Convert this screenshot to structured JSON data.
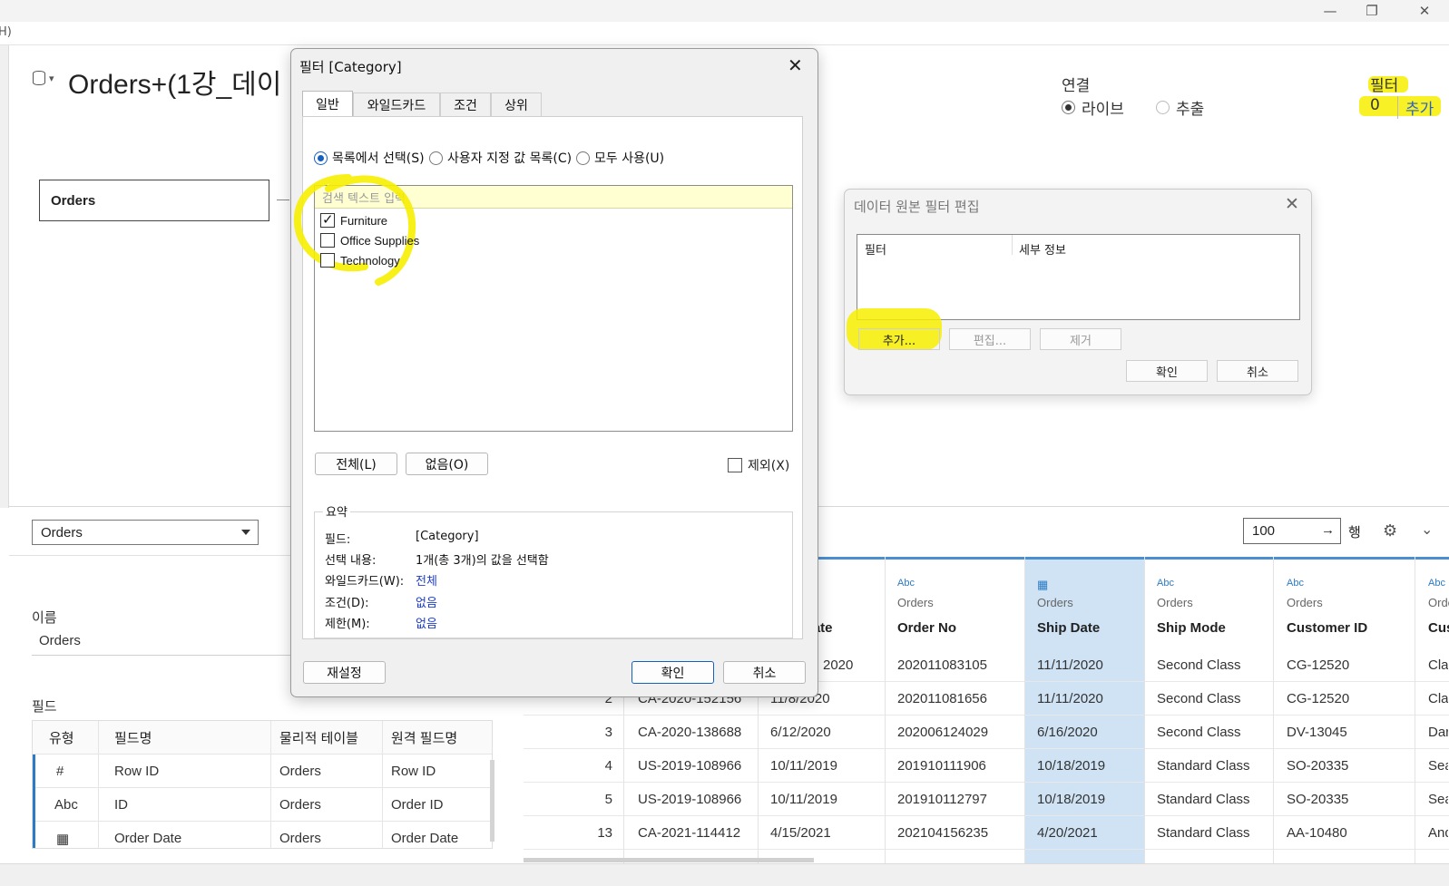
{
  "window": {
    "minimize": "—",
    "maximize": "❐",
    "close": "✕"
  },
  "menubar": {
    "first_char": "H)"
  },
  "datasource": {
    "title": "Orders+(1강_데이",
    "table_box": "Orders",
    "icon": "database-icon"
  },
  "connection": {
    "label": "연결",
    "live": "라이브",
    "extract": "추출",
    "selected": "live"
  },
  "filters": {
    "label": "필터",
    "count": "0",
    "add": "추가"
  },
  "bottom": {
    "table_select": "Orders",
    "name_label": "이름",
    "name_value": "Orders",
    "fields_label": "필드",
    "rows_value": "100",
    "rows_suffix": "행",
    "rows_arrow": "→",
    "gear_icon": "⚙",
    "chevron_icon": "⌄"
  },
  "fields_table": {
    "headers": [
      "유형",
      "필드명",
      "물리적 테이블",
      "원격 필드명"
    ],
    "rows": [
      {
        "type": "#",
        "name": "Row ID",
        "table": "Orders",
        "remote": "Row ID"
      },
      {
        "type": "Abc",
        "name": "ID",
        "table": "Orders",
        "remote": "Order ID"
      },
      {
        "type": "▦",
        "name": "Order Date",
        "table": "Orders",
        "remote": "Order Date"
      }
    ]
  },
  "grid": {
    "columns": [
      {
        "icon": "",
        "table": "",
        "name": "Date"
      },
      {
        "icon": "Abc",
        "table": "Orders",
        "name": "Order No"
      },
      {
        "icon": "▦",
        "table": "Orders",
        "name": "Ship Date"
      },
      {
        "icon": "Abc",
        "table": "Orders",
        "name": "Ship Mode"
      },
      {
        "icon": "Abc",
        "table": "Orders",
        "name": "Customer ID"
      },
      {
        "icon": "Abc",
        "table": "Orde",
        "name": "Cus"
      }
    ],
    "rows": [
      {
        "row_id": "",
        "order_id": "",
        "order_date": "2020",
        "order_no": "202011083105",
        "ship_date": "11/11/2020",
        "ship_mode": "Second Class",
        "customer_id": "CG-12520",
        "cust": "Cla"
      },
      {
        "row_id": "2",
        "order_id": "CA-2020-152156",
        "order_date": "11/8/2020",
        "order_no": "202011081656",
        "ship_date": "11/11/2020",
        "ship_mode": "Second Class",
        "customer_id": "CG-12520",
        "cust": "Cla"
      },
      {
        "row_id": "3",
        "order_id": "CA-2020-138688",
        "order_date": "6/12/2020",
        "order_no": "202006124029",
        "ship_date": "6/16/2020",
        "ship_mode": "Second Class",
        "customer_id": "DV-13045",
        "cust": "Dar"
      },
      {
        "row_id": "4",
        "order_id": "US-2019-108966",
        "order_date": "10/11/2019",
        "order_no": "201910111906",
        "ship_date": "10/18/2019",
        "ship_mode": "Standard Class",
        "customer_id": "SO-20335",
        "cust": "Sea"
      },
      {
        "row_id": "5",
        "order_id": "US-2019-108966",
        "order_date": "10/11/2019",
        "order_no": "201910112797",
        "ship_date": "10/18/2019",
        "ship_mode": "Standard Class",
        "customer_id": "SO-20335",
        "cust": "Sea"
      },
      {
        "row_id": "13",
        "order_id": "CA-2021-114412",
        "order_date": "4/15/2021",
        "order_no": "202104156235",
        "ship_date": "4/20/2021",
        "ship_mode": "Standard Class",
        "customer_id": "AA-10480",
        "cust": "And"
      }
    ]
  },
  "filter_dialog": {
    "title": "필터 [Category]",
    "close": "✕",
    "tabs": [
      "일반",
      "와일드카드",
      "조건",
      "상위"
    ],
    "active_tab": 0,
    "radio": {
      "list": "목록에서 선택(S)",
      "custom": "사용자 지정 값 목록(C)",
      "all": "모두 사용(U)",
      "selected": "list"
    },
    "search_placeholder": "검색 텍스트 입력",
    "items": [
      {
        "label": "Furniture",
        "checked": true
      },
      {
        "label": "Office Supplies",
        "checked": false
      },
      {
        "label": "Technology",
        "checked": false
      }
    ],
    "btn_all": "전체(L)",
    "btn_none": "없음(O)",
    "exclude": "제외(X)",
    "summary": {
      "title": "요약",
      "rows": [
        {
          "label": "필드:",
          "value": "[Category]"
        },
        {
          "label": "선택 내용:",
          "value": "1개(총 3개)의 값을 선택함"
        },
        {
          "label": "와일드카드(W):",
          "value": "전체"
        },
        {
          "label": "조건(D):",
          "value": "없음"
        },
        {
          "label": "제한(M):",
          "value": "없음"
        }
      ]
    },
    "reset": "재설정",
    "ok": "확인",
    "cancel": "취소"
  },
  "ds_filter_dialog": {
    "title": "데이터 원본 필터 편집",
    "close": "✕",
    "col_filter": "필터",
    "col_detail": "세부 정보",
    "add": "추가...",
    "edit": "편집...",
    "remove": "제거",
    "ok": "확인",
    "cancel": "취소"
  },
  "colors": {
    "accent": "#1460c0",
    "highlight": "#f7ee00",
    "ship_date_bg": "#cfe3f5",
    "link": "#2b63c4"
  }
}
